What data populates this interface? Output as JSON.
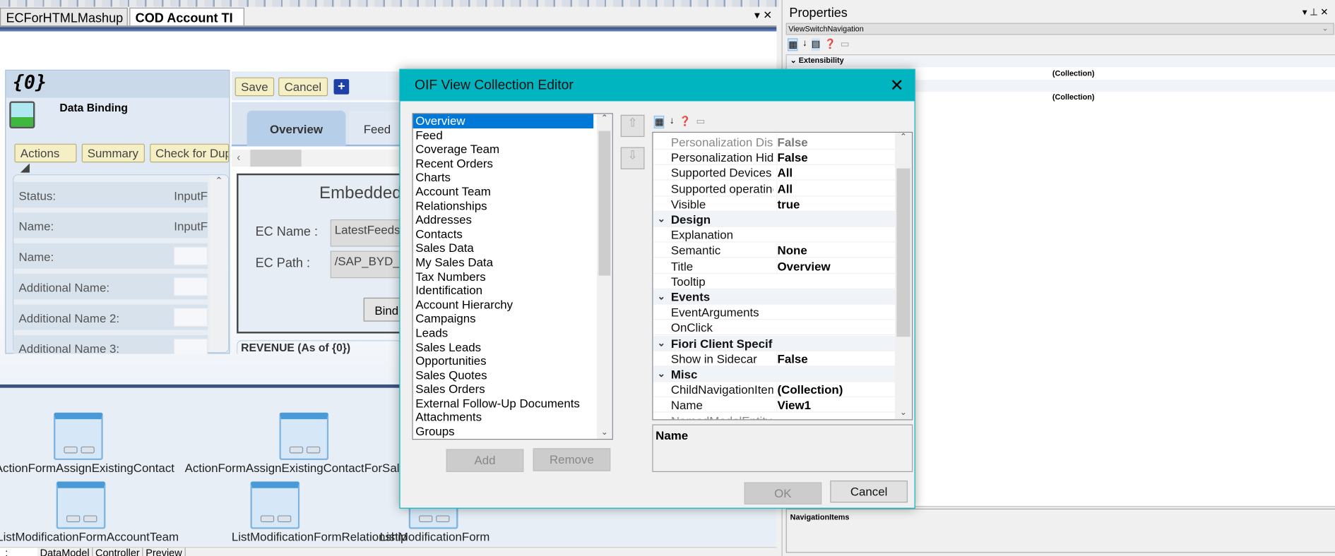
{
  "doc_tabs": [
    {
      "label": "ECForHTMLMashup"
    },
    {
      "label": "COD Account TI"
    }
  ],
  "designer": {
    "header_token": "{0}",
    "data_binding": "Data Binding",
    "buttons": {
      "actions": "Actions ◢",
      "summary": "Summary",
      "check": "Check for Dup",
      "save": "Save",
      "cancel": "Cancel"
    },
    "form_rows": [
      {
        "label": "Status:",
        "value": "InputF"
      },
      {
        "label": "Name:",
        "value": "InputF"
      },
      {
        "label": "Name:",
        "value": ""
      },
      {
        "label": "Additional Name:",
        "value": ""
      },
      {
        "label": "Additional Name 2:",
        "value": ""
      },
      {
        "label": "Additional Name 3:",
        "value": ""
      }
    ],
    "tabs": [
      "Overview",
      "Feed"
    ],
    "embedded": {
      "title": "Embedded",
      "ec_name_label": "EC Name :",
      "ec_name": "LatestFeeds_",
      "ec_path_label": "EC Path :",
      "ec_path": "/SAP_BYD_A",
      "bind": "Bind"
    },
    "revenue": "REVENUE (As of {0})",
    "components": [
      "ActionFormAssignExistingContact",
      "ActionFormAssignExistingContactForSales",
      "ListModificationFormAccountTeam",
      "ListModificationFormRelationship",
      "ListModificationForm"
    ],
    "bottom_tabs": [
      ":",
      "DataModel",
      "Controller",
      "Preview"
    ]
  },
  "properties": {
    "title": "Properties",
    "object": "ViewSwitchNavigation",
    "category": "Extensibility",
    "values": [
      "(Collection)",
      "(Collection)"
    ],
    "description_title": "NavigationItems"
  },
  "dialog": {
    "title": "OIF View Collection Editor",
    "items": [
      "Overview",
      "Feed",
      "Coverage Team",
      "Recent Orders",
      "Charts",
      "Account Team",
      "Relationships",
      "Addresses",
      "Contacts",
      "Sales Data",
      "My Sales Data",
      "Tax Numbers",
      "Identification",
      "Account Hierarchy",
      "Campaigns",
      "Leads",
      "Sales Leads",
      "Opportunities",
      "Sales Quotes",
      "Sales Orders",
      "External Follow-Up Documents",
      "Attachments",
      "Groups"
    ],
    "selected": "Overview",
    "add": "Add",
    "remove": "Remove",
    "ok": "OK",
    "cancel": "Cancel",
    "grid": [
      {
        "k": "Personalization Disa",
        "v": "False"
      },
      {
        "k": "Personalization Hidd",
        "v": "False"
      },
      {
        "k": "Supported Devices",
        "v": "All"
      },
      {
        "k": "Supported operating",
        "v": "All"
      },
      {
        "k": "Visible",
        "v": "true"
      },
      {
        "cat": "Design"
      },
      {
        "k": "Explanation",
        "v": ""
      },
      {
        "k": "Semantic",
        "v": "None"
      },
      {
        "k": "Title",
        "v": "Overview"
      },
      {
        "k": "Tooltip",
        "v": ""
      },
      {
        "cat": "Events"
      },
      {
        "k": "EventArguments",
        "v": ""
      },
      {
        "k": "OnClick",
        "v": ""
      },
      {
        "cat": "Fiori Client Specific"
      },
      {
        "k": "Show in Sidecar",
        "v": "False"
      },
      {
        "cat": "Misc"
      },
      {
        "k": "ChildNavigationItem",
        "v": "(Collection)"
      },
      {
        "k": "Name",
        "v": "View1"
      },
      {
        "k": "NamedModelEntity",
        "v": ""
      }
    ],
    "description_title": "Name"
  },
  "colors": {
    "dialog_title": "#00b4c0",
    "selection": "#0078d7",
    "sap_button": "#f5efc6"
  }
}
